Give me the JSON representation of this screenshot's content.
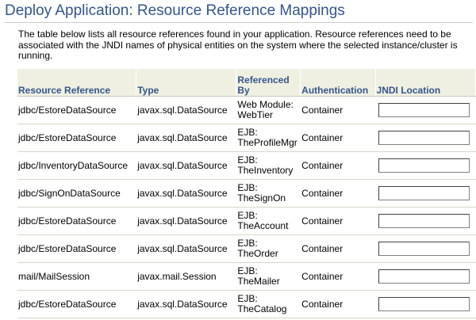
{
  "page": {
    "title": "Deploy Application: Resource Reference Mappings",
    "description": "The table below lists all resource references found in your application. Resource references need to be associated with the JNDI names of physical entities on the system where the selected instance/cluster is running."
  },
  "table": {
    "headers": {
      "resource_reference": "Resource Reference",
      "type": "Type",
      "referenced_by": "Referenced By",
      "authentication": "Authentication",
      "jndi_location": "JNDI Location"
    },
    "rows": [
      {
        "ref": "jdbc/EstoreDataSource",
        "type": "javax.sql.DataSource",
        "by1": "Web Module:",
        "by2": "WebTier",
        "auth": "Container",
        "jndi": ""
      },
      {
        "ref": "jdbc/EstoreDataSource",
        "type": "javax.sql.DataSource",
        "by1": "EJB:",
        "by2": "TheProfileMgr",
        "auth": "Container",
        "jndi": ""
      },
      {
        "ref": "jdbc/InventoryDataSource",
        "type": "javax.sql.DataSource",
        "by1": "EJB:",
        "by2": "TheInventory",
        "auth": "Container",
        "jndi": ""
      },
      {
        "ref": "jdbc/SignOnDataSource",
        "type": "javax.sql.DataSource",
        "by1": "EJB:",
        "by2": "TheSignOn",
        "auth": "Container",
        "jndi": ""
      },
      {
        "ref": "jdbc/EstoreDataSource",
        "type": "javax.sql.DataSource",
        "by1": "EJB:",
        "by2": "TheAccount",
        "auth": "Container",
        "jndi": ""
      },
      {
        "ref": "jdbc/EstoreDataSource",
        "type": "javax.sql.DataSource",
        "by1": "EJB:",
        "by2": "TheOrder",
        "auth": "Container",
        "jndi": ""
      },
      {
        "ref": "mail/MailSession",
        "type": "javax.mail.Session",
        "by1": "EJB:",
        "by2": "TheMailer",
        "auth": "Container",
        "jndi": ""
      },
      {
        "ref": "jdbc/EstoreDataSource",
        "type": "javax.sql.DataSource",
        "by1": "EJB:",
        "by2": "TheCatalog",
        "auth": "Container",
        "jndi": ""
      }
    ]
  },
  "colors": {
    "title": "#33558c",
    "header_bg": "#f0f0e2"
  }
}
